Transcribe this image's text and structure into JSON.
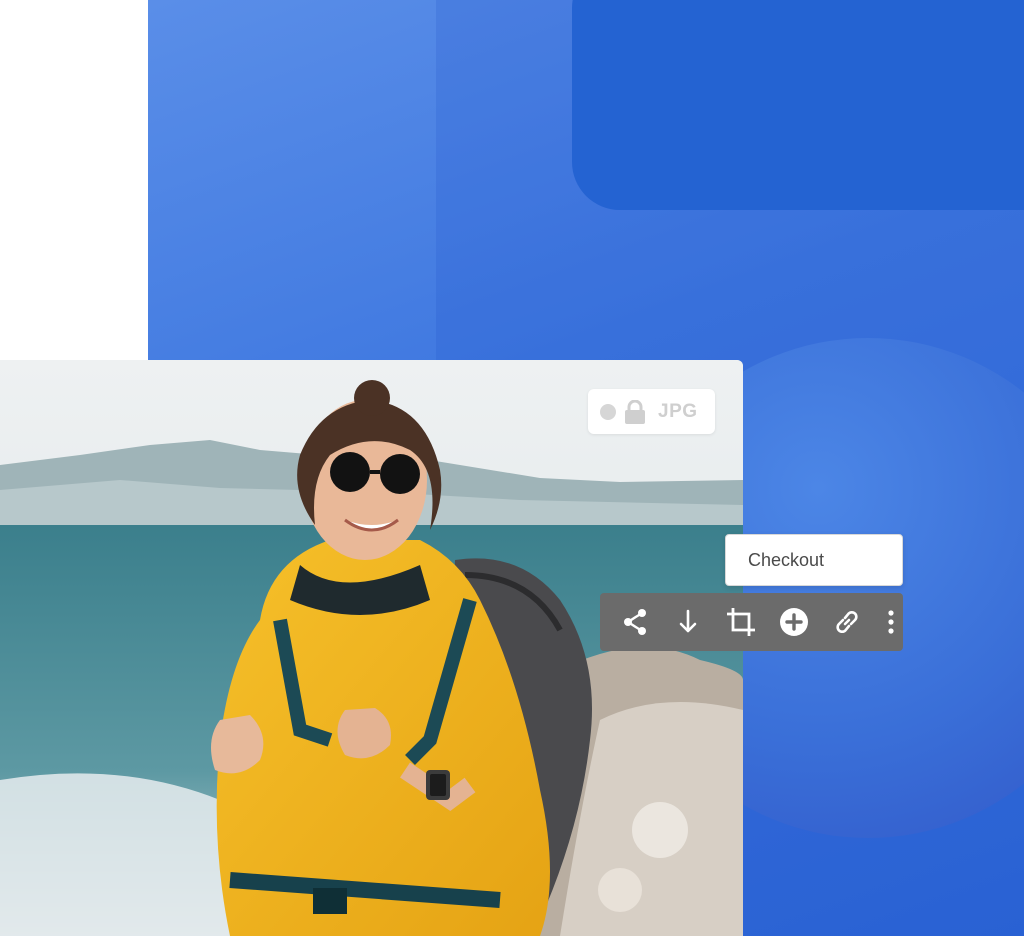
{
  "file_badge": {
    "format_label": "JPG",
    "lock_icon": "lock-icon",
    "status_dot_icon": "status-dot-icon"
  },
  "checkout": {
    "label": "Checkout"
  },
  "toolbar": {
    "items": [
      {
        "icon": "share-icon"
      },
      {
        "icon": "download-icon"
      },
      {
        "icon": "crop-icon"
      },
      {
        "icon": "add-circle-icon"
      },
      {
        "icon": "link-icon"
      },
      {
        "icon": "more-vertical-icon"
      }
    ]
  },
  "colors": {
    "brand_blue": "#3f78e0",
    "toolbar_bg": "#6b6b6b",
    "jacket_yellow": "#f2b21c"
  }
}
